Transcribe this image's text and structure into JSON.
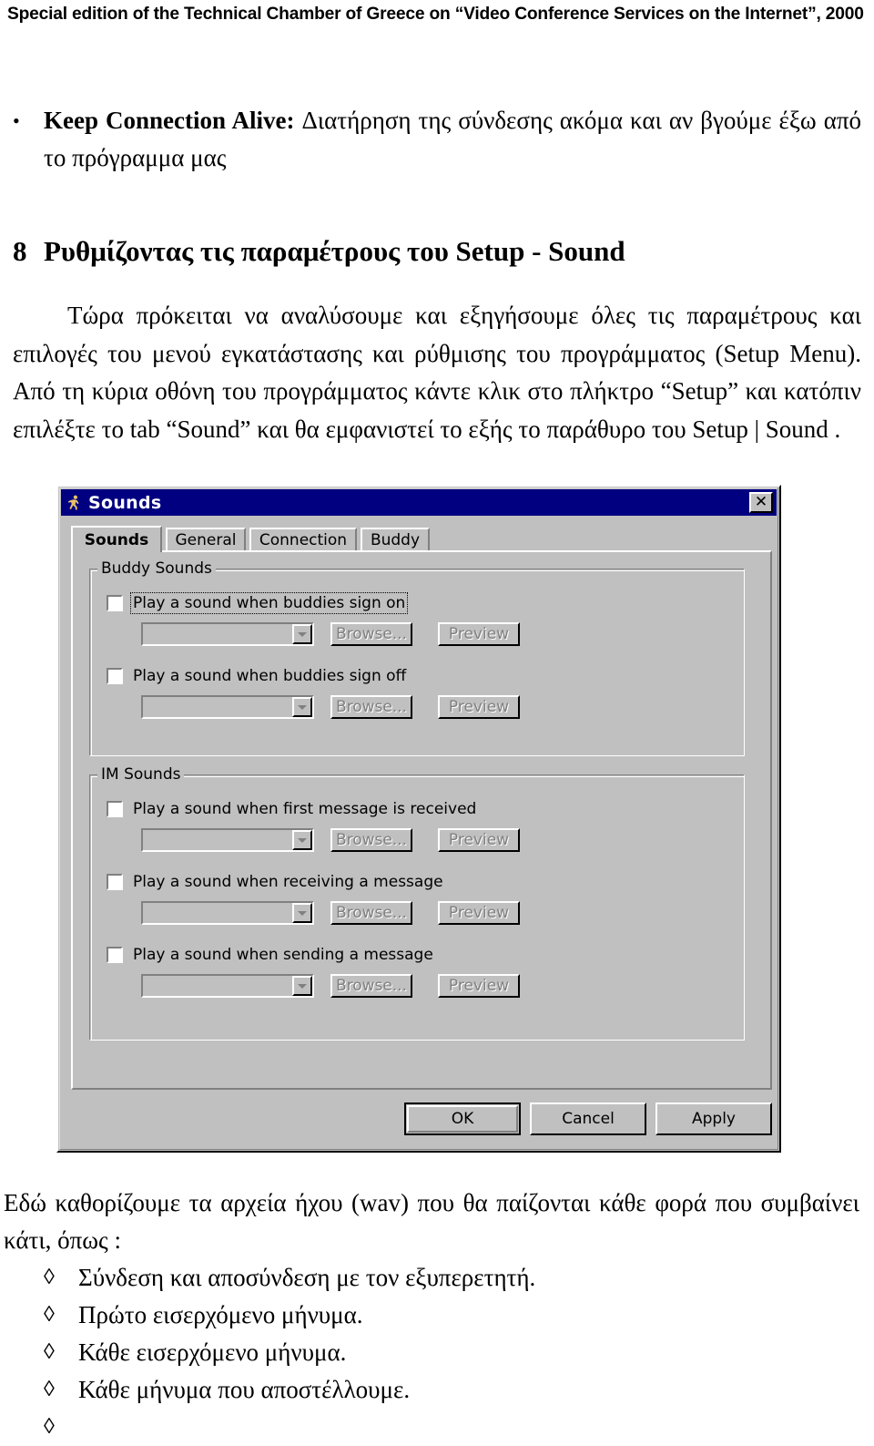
{
  "header": {
    "running_head": "Special edition of the Technical Chamber of Greece on “Video Conference Services on the Internet”, 2000"
  },
  "document": {
    "bullet_item": {
      "bullet_glyph": "•",
      "lead": "Keep Connection Alive:",
      "text": " Διατήρηση της σύνδεσης ακόμα και αν βγούμε έξω από το πρόγραμμα μας"
    },
    "section": {
      "number": "8",
      "title": "Ρυθμίζοντας τις παραμέτρους του Setup - Sound"
    },
    "intro_paragraph": "Τώρα πρόκειται να αναλύσουμε και εξηγήσουμε όλες τις παραμέτρους και επιλογές του μενού εγκατάστασης και ρύθμισης του προγράμματος (Setup Menu). Από τη κύρια οθόνη του προγράμματος κάντε κλικ στο πλήκτρο “Setup” και κατόπιν επιλέξτε το tab “Sound” και θα εμφανιστεί το εξής το παράθυρο του Setup | Sound .",
    "closing_paragraph": "Εδώ καθορίζουμε τα αρχεία ήχου (wav) που θα παίζονται κάθε φορά που συμβαίνει κάτι, όπως :",
    "diamond_glyph": "◊",
    "diamond_items": [
      "Σύνδεση και αποσύνδεση με τον εξυπερετητή.",
      "Πρώτο εισερχόμενο μήνυμα.",
      "Κάθε εισερχόμενο μήνυμα.",
      "Κάθε μήνυμα που αποστέλλουμε.",
      ""
    ]
  },
  "dialog": {
    "title": "Sounds",
    "icon": "running-man-icon",
    "close_label": "✕",
    "title_bar_color": "#000080",
    "face_color": "#c0c0c0",
    "tabs": [
      {
        "label": "Sounds",
        "active": true
      },
      {
        "label": "General",
        "active": false
      },
      {
        "label": "Connection",
        "active": false
      },
      {
        "label": "Buddy",
        "active": false
      }
    ],
    "groups": [
      {
        "label": "Buddy Sounds",
        "rows": [
          {
            "checkbox_label": "Play a sound when buddies sign on",
            "checked": false,
            "focused": true,
            "combo_value": "",
            "browse_label": "Browse...",
            "preview_label": "Preview",
            "disabled": true
          },
          {
            "checkbox_label": "Play a sound when buddies sign off",
            "checked": false,
            "focused": false,
            "combo_value": "",
            "browse_label": "Browse...",
            "preview_label": "Preview",
            "disabled": true
          }
        ]
      },
      {
        "label": "IM Sounds",
        "rows": [
          {
            "checkbox_label": "Play a sound when first message is received",
            "checked": false,
            "focused": false,
            "combo_value": "",
            "browse_label": "Browse...",
            "preview_label": "Preview",
            "disabled": true
          },
          {
            "checkbox_label": "Play a sound when receiving a message",
            "checked": false,
            "focused": false,
            "combo_value": "",
            "browse_label": "Browse...",
            "preview_label": "Preview",
            "disabled": true
          },
          {
            "checkbox_label": "Play a sound when sending a message",
            "checked": false,
            "focused": false,
            "combo_value": "",
            "browse_label": "Browse...",
            "preview_label": "Preview",
            "disabled": true
          }
        ]
      }
    ],
    "footer_buttons": [
      {
        "label": "OK",
        "default": true
      },
      {
        "label": "Cancel",
        "default": false
      },
      {
        "label": "Apply",
        "default": false
      }
    ]
  }
}
